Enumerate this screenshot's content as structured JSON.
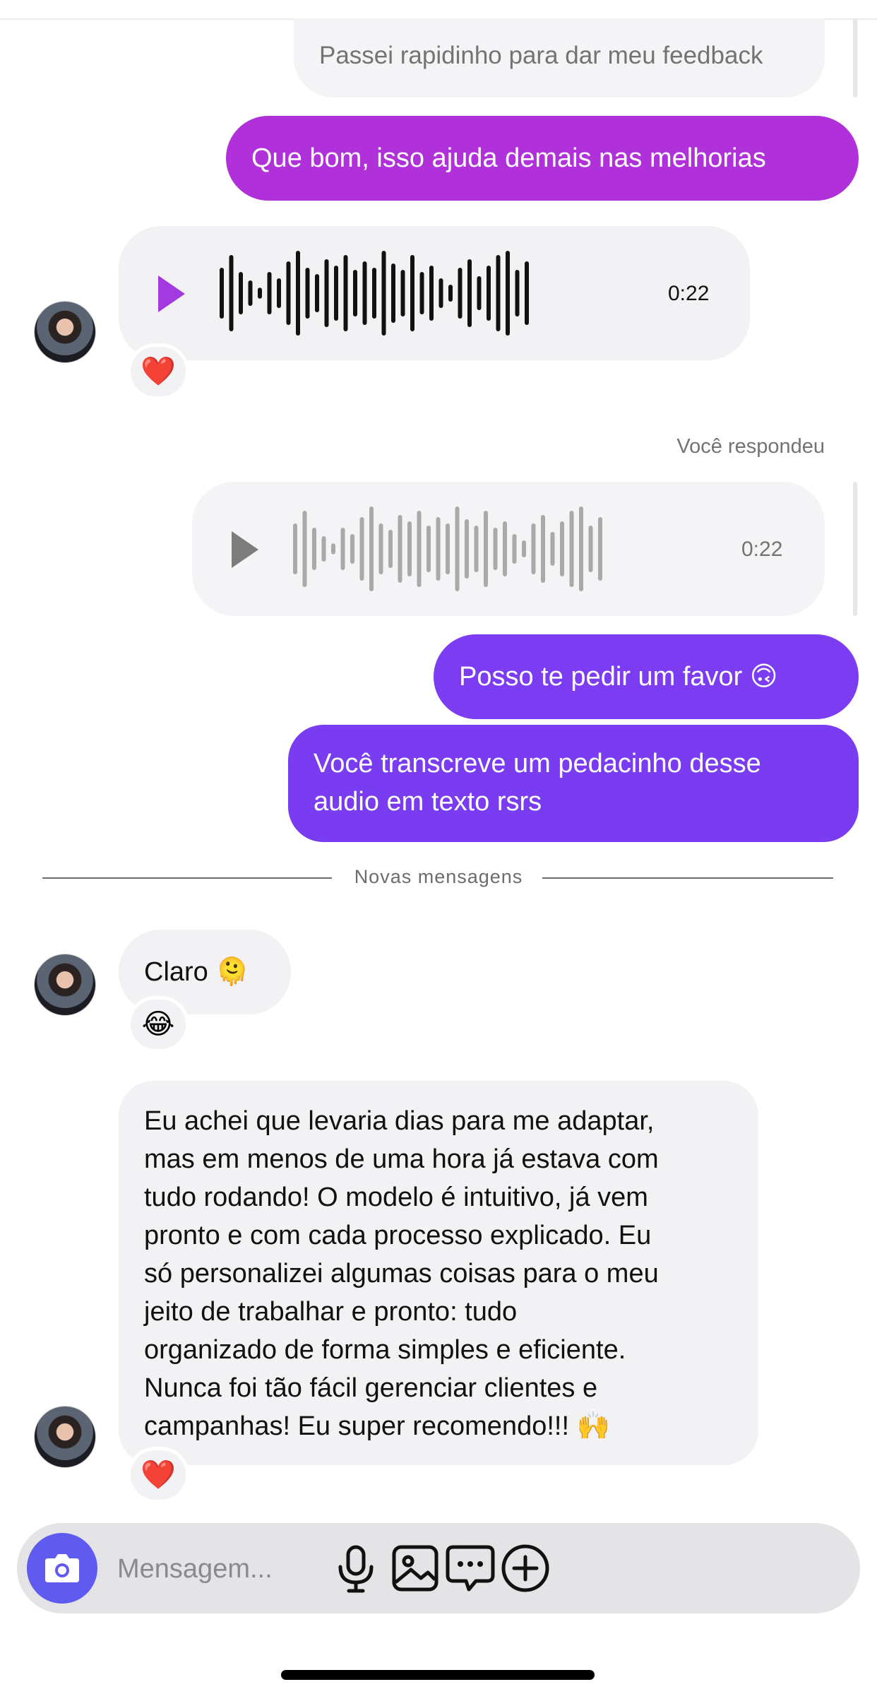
{
  "messages": {
    "m1": "Passei rapidinho para dar meu feedback",
    "m2": "Que bom, isso ajuda demais nas melhorias",
    "voice1_duration": "0:22",
    "voice1_reaction": "❤️",
    "replied_label": "Você respondeu",
    "voice2_duration": "0:22",
    "m3": "Posso te pedir um favor 🙃",
    "m4_lines": [
      "Você transcreve um pedacinho desse",
      "audio em texto rsrs"
    ],
    "divider_label": "Novas mensagens",
    "m5": "Claro 🫠",
    "m5_reaction": "😂",
    "m6_lines": [
      "Eu achei que levaria dias para me adaptar,",
      "mas em menos de uma hora já estava com",
      "tudo rodando! O modelo é intuitivo, já vem",
      "pronto e com cada processo explicado. Eu",
      "só personalizei algumas coisas para o meu",
      "jeito de trabalhar e pronto: tudo",
      "organizado de forma simples e eficiente.",
      "Nunca foi tão fácil gerenciar clientes e",
      "campanhas! Eu super recomendo!!! 🙌"
    ],
    "m6_reaction": "❤️"
  },
  "composer": {
    "placeholder": "Mensagem...",
    "icons": [
      "camera-icon",
      "microphone-icon",
      "image-icon",
      "sticker-chat-icon",
      "plus-icon"
    ]
  },
  "colors": {
    "outgoing_magenta": "#b030d9",
    "outgoing_purple": "#7a3cf0",
    "incoming_bg": "#f2f2f4",
    "camera_blue": "#5f5bf0"
  }
}
